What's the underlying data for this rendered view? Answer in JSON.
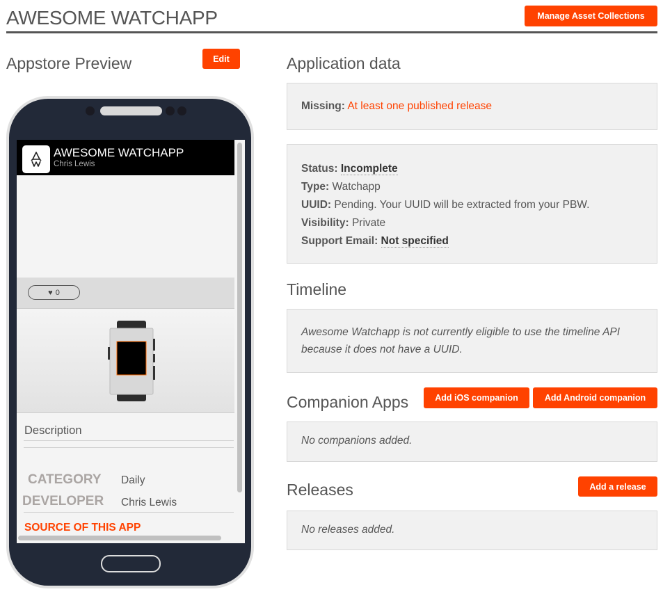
{
  "header": {
    "title": "AWESOME WATCHAPP",
    "manage_button": "Manage Asset Collections"
  },
  "preview": {
    "heading": "Appstore Preview",
    "edit_button": "Edit",
    "app_name": "AWESOME WATCHAPP",
    "developer": "Chris Lewis",
    "likes": "0",
    "description_label": "Description",
    "category_label": "CATEGORY",
    "category_value": "Daily",
    "developer_label": "DEVELOPER",
    "developer_value": "Chris Lewis",
    "source_link": "SOURCE OF THIS APP"
  },
  "application_data": {
    "heading": "Application data",
    "missing_label": "Missing:",
    "missing_value": "At least one published release",
    "fields": [
      {
        "label": "Status:",
        "value": "Incomplete"
      },
      {
        "label": "Type:",
        "value": "Watchapp"
      },
      {
        "label": "UUID:",
        "value": "Pending. Your UUID will be extracted from your PBW."
      },
      {
        "label": "Visibility:",
        "value": "Private"
      },
      {
        "label": "Support Email:",
        "value": "Not specified"
      }
    ]
  },
  "timeline": {
    "heading": "Timeline",
    "message": "Awesome Watchapp is not currently eligible to use the timeline API because it does not have a UUID."
  },
  "companion": {
    "heading": "Companion Apps",
    "ios_button": "Add iOS companion",
    "android_button": "Add Android companion",
    "empty": "No companions added."
  },
  "releases": {
    "heading": "Releases",
    "add_button": "Add a release",
    "empty": "No releases added."
  },
  "colors": {
    "accent": "#ff4200",
    "phone_body": "#222938"
  }
}
